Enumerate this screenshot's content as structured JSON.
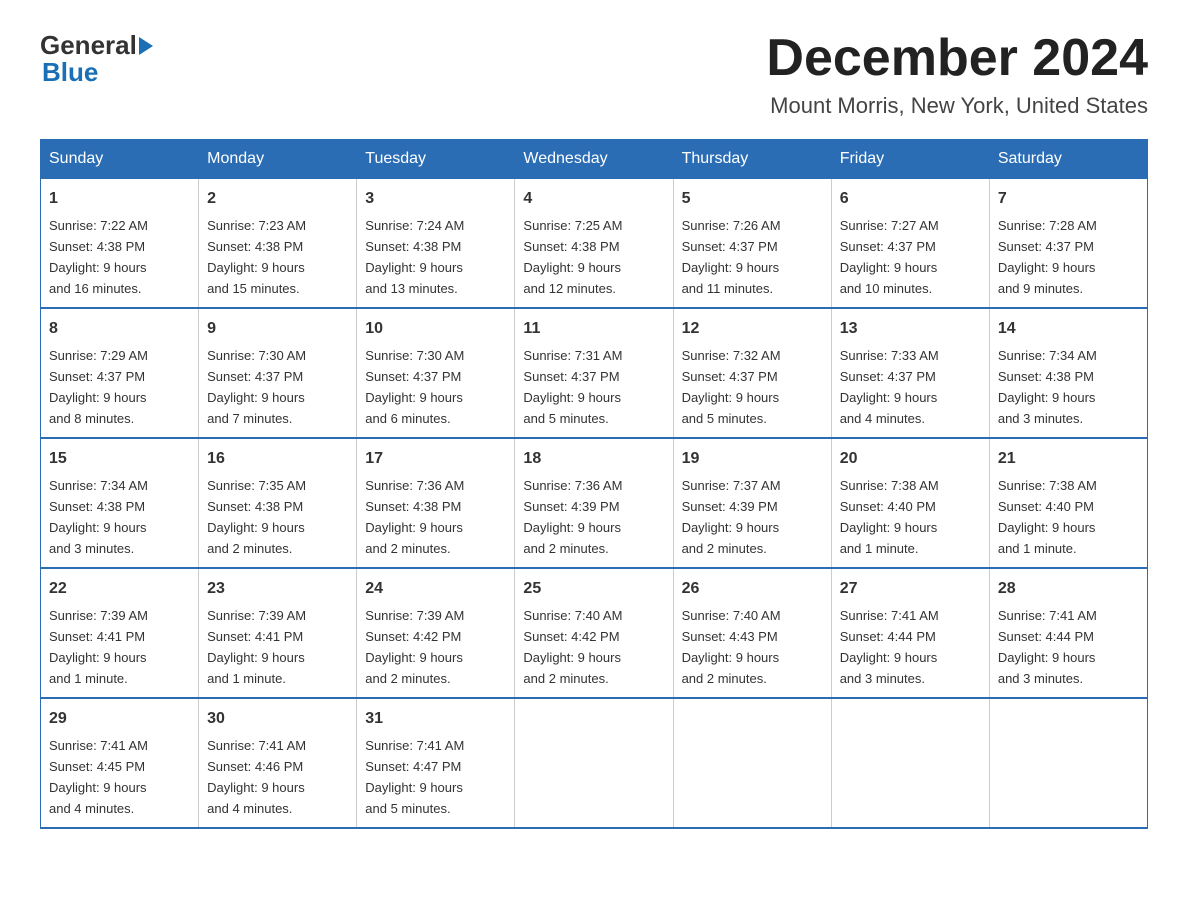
{
  "logo": {
    "general_text": "General",
    "blue_text": "Blue"
  },
  "header": {
    "title": "December 2024",
    "subtitle": "Mount Morris, New York, United States"
  },
  "days_of_week": [
    "Sunday",
    "Monday",
    "Tuesday",
    "Wednesday",
    "Thursday",
    "Friday",
    "Saturday"
  ],
  "weeks": [
    [
      {
        "day": "1",
        "sunrise": "7:22 AM",
        "sunset": "4:38 PM",
        "daylight": "9 hours and 16 minutes."
      },
      {
        "day": "2",
        "sunrise": "7:23 AM",
        "sunset": "4:38 PM",
        "daylight": "9 hours and 15 minutes."
      },
      {
        "day": "3",
        "sunrise": "7:24 AM",
        "sunset": "4:38 PM",
        "daylight": "9 hours and 13 minutes."
      },
      {
        "day": "4",
        "sunrise": "7:25 AM",
        "sunset": "4:38 PM",
        "daylight": "9 hours and 12 minutes."
      },
      {
        "day": "5",
        "sunrise": "7:26 AM",
        "sunset": "4:37 PM",
        "daylight": "9 hours and 11 minutes."
      },
      {
        "day": "6",
        "sunrise": "7:27 AM",
        "sunset": "4:37 PM",
        "daylight": "9 hours and 10 minutes."
      },
      {
        "day": "7",
        "sunrise": "7:28 AM",
        "sunset": "4:37 PM",
        "daylight": "9 hours and 9 minutes."
      }
    ],
    [
      {
        "day": "8",
        "sunrise": "7:29 AM",
        "sunset": "4:37 PM",
        "daylight": "9 hours and 8 minutes."
      },
      {
        "day": "9",
        "sunrise": "7:30 AM",
        "sunset": "4:37 PM",
        "daylight": "9 hours and 7 minutes."
      },
      {
        "day": "10",
        "sunrise": "7:30 AM",
        "sunset": "4:37 PM",
        "daylight": "9 hours and 6 minutes."
      },
      {
        "day": "11",
        "sunrise": "7:31 AM",
        "sunset": "4:37 PM",
        "daylight": "9 hours and 5 minutes."
      },
      {
        "day": "12",
        "sunrise": "7:32 AM",
        "sunset": "4:37 PM",
        "daylight": "9 hours and 5 minutes."
      },
      {
        "day": "13",
        "sunrise": "7:33 AM",
        "sunset": "4:37 PM",
        "daylight": "9 hours and 4 minutes."
      },
      {
        "day": "14",
        "sunrise": "7:34 AM",
        "sunset": "4:38 PM",
        "daylight": "9 hours and 3 minutes."
      }
    ],
    [
      {
        "day": "15",
        "sunrise": "7:34 AM",
        "sunset": "4:38 PM",
        "daylight": "9 hours and 3 minutes."
      },
      {
        "day": "16",
        "sunrise": "7:35 AM",
        "sunset": "4:38 PM",
        "daylight": "9 hours and 2 minutes."
      },
      {
        "day": "17",
        "sunrise": "7:36 AM",
        "sunset": "4:38 PM",
        "daylight": "9 hours and 2 minutes."
      },
      {
        "day": "18",
        "sunrise": "7:36 AM",
        "sunset": "4:39 PM",
        "daylight": "9 hours and 2 minutes."
      },
      {
        "day": "19",
        "sunrise": "7:37 AM",
        "sunset": "4:39 PM",
        "daylight": "9 hours and 2 minutes."
      },
      {
        "day": "20",
        "sunrise": "7:38 AM",
        "sunset": "4:40 PM",
        "daylight": "9 hours and 1 minute."
      },
      {
        "day": "21",
        "sunrise": "7:38 AM",
        "sunset": "4:40 PM",
        "daylight": "9 hours and 1 minute."
      }
    ],
    [
      {
        "day": "22",
        "sunrise": "7:39 AM",
        "sunset": "4:41 PM",
        "daylight": "9 hours and 1 minute."
      },
      {
        "day": "23",
        "sunrise": "7:39 AM",
        "sunset": "4:41 PM",
        "daylight": "9 hours and 1 minute."
      },
      {
        "day": "24",
        "sunrise": "7:39 AM",
        "sunset": "4:42 PM",
        "daylight": "9 hours and 2 minutes."
      },
      {
        "day": "25",
        "sunrise": "7:40 AM",
        "sunset": "4:42 PM",
        "daylight": "9 hours and 2 minutes."
      },
      {
        "day": "26",
        "sunrise": "7:40 AM",
        "sunset": "4:43 PM",
        "daylight": "9 hours and 2 minutes."
      },
      {
        "day": "27",
        "sunrise": "7:41 AM",
        "sunset": "4:44 PM",
        "daylight": "9 hours and 3 minutes."
      },
      {
        "day": "28",
        "sunrise": "7:41 AM",
        "sunset": "4:44 PM",
        "daylight": "9 hours and 3 minutes."
      }
    ],
    [
      {
        "day": "29",
        "sunrise": "7:41 AM",
        "sunset": "4:45 PM",
        "daylight": "9 hours and 4 minutes."
      },
      {
        "day": "30",
        "sunrise": "7:41 AM",
        "sunset": "4:46 PM",
        "daylight": "9 hours and 4 minutes."
      },
      {
        "day": "31",
        "sunrise": "7:41 AM",
        "sunset": "4:47 PM",
        "daylight": "9 hours and 5 minutes."
      },
      null,
      null,
      null,
      null
    ]
  ],
  "labels": {
    "sunrise_prefix": "Sunrise: ",
    "sunset_prefix": "Sunset: ",
    "daylight_prefix": "Daylight: "
  }
}
